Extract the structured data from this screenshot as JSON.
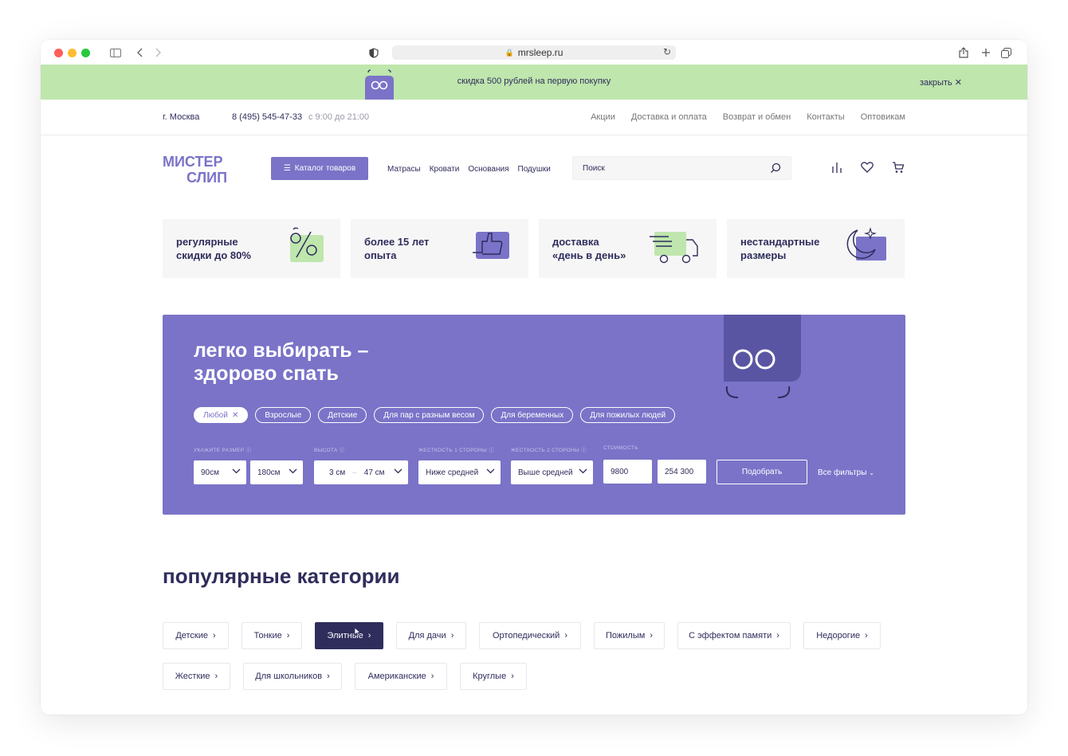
{
  "browser": {
    "url": "mrsleep.ru"
  },
  "promo": {
    "text": "скидка 500 рублей на первую покупку",
    "close": "закрыть"
  },
  "info": {
    "city": "г. Москва",
    "phone": "8 (495) 545-47-33",
    "hours": "с 9:00 до 21:00",
    "nav": [
      "Акции",
      "Доставка и оплата",
      "Возврат и обмен",
      "Контакты",
      "Оптовикам"
    ]
  },
  "header": {
    "logo_line1": "МИСТЕР",
    "logo_line2": "СЛИП",
    "catalog_button": "Каталог товаров",
    "nav": [
      "Матрасы",
      "Кровати",
      "Основания",
      "Подушки"
    ],
    "search_placeholder": "Поиск"
  },
  "features": [
    {
      "text": "регулярные\nскидки до 80%",
      "icon": "percent-icon"
    },
    {
      "text": "более 15 лет\nопыта",
      "icon": "thumbs-up-icon"
    },
    {
      "text": "доставка\n«день в день»",
      "icon": "truck-icon"
    },
    {
      "text": "нестандартные\nразмеры",
      "icon": "moon-star-icon"
    }
  ],
  "hero": {
    "title": "легко выбирать –\nздорово спать",
    "chips": [
      "Любой",
      "Взрослые",
      "Детские",
      "Для пар с разным весом",
      "Для беременных",
      "Для пожилых людей"
    ],
    "labels": {
      "size": "укажите размер",
      "height": "высота",
      "firm1": "жесткость 1 стороны",
      "firm2": "жесткость 2 стороны",
      "price": "стоимость"
    },
    "size_w": "90см",
    "size_l": "180см",
    "height_from": "3 см",
    "height_to": "47 см",
    "firm1": "Ниже средней",
    "firm2": "Выше средней",
    "price_from": "9800",
    "price_to": "254 300",
    "submit": "Подобрать",
    "all_filters": "Все фильтры"
  },
  "popular": {
    "title": "популярные категории",
    "row1": [
      "Детские",
      "Тонкие",
      "Элитные",
      "Для дачи",
      "Ортопедический",
      "Пожилым",
      "С эффектом памяти",
      "Недорогие"
    ],
    "row2": [
      "Жесткие",
      "Для школьников",
      "Американские",
      "Круглые"
    ],
    "active": "Элитные"
  },
  "colors": {
    "brand_purple": "#7a73c8",
    "dark_navy": "#2f2d5c",
    "promo_green": "#bfe6ad",
    "feature_bg": "#f6f6f6"
  }
}
